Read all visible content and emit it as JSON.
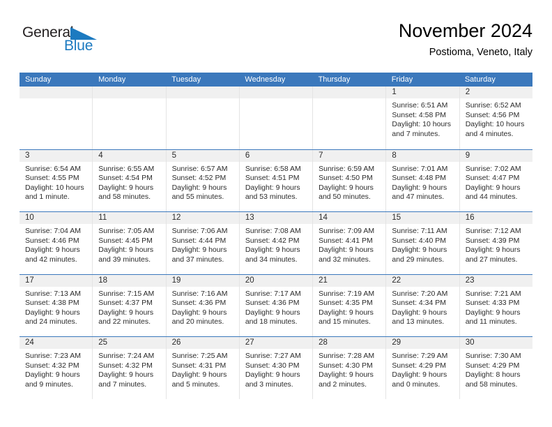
{
  "brand": {
    "name_top": "General",
    "name_bottom": "Blue",
    "triangle_icon": "blue-triangle-icon",
    "accent_color": "#1c7ac0"
  },
  "header": {
    "title": "November 2024",
    "subtitle": "Postioma, Veneto, Italy"
  },
  "theme": {
    "header_bg": "#3b78bc",
    "date_strip_bg": "#f0f0f0",
    "cell_border": "#e4e4e4",
    "text": "#2b2b2b"
  },
  "weekdays": [
    "Sunday",
    "Monday",
    "Tuesday",
    "Wednesday",
    "Thursday",
    "Friday",
    "Saturday"
  ],
  "labels": {
    "sunrise": "Sunrise:",
    "sunset": "Sunset:",
    "daylight": "Daylight:"
  },
  "weeks": [
    [
      {
        "day": "",
        "empty": true
      },
      {
        "day": "",
        "empty": true
      },
      {
        "day": "",
        "empty": true
      },
      {
        "day": "",
        "empty": true
      },
      {
        "day": "",
        "empty": true
      },
      {
        "day": "1",
        "sunrise": "Sunrise: 6:51 AM",
        "sunset": "Sunset: 4:58 PM",
        "daylight1": "Daylight: 10 hours",
        "daylight2": "and 7 minutes."
      },
      {
        "day": "2",
        "sunrise": "Sunrise: 6:52 AM",
        "sunset": "Sunset: 4:56 PM",
        "daylight1": "Daylight: 10 hours",
        "daylight2": "and 4 minutes."
      }
    ],
    [
      {
        "day": "3",
        "sunrise": "Sunrise: 6:54 AM",
        "sunset": "Sunset: 4:55 PM",
        "daylight1": "Daylight: 10 hours",
        "daylight2": "and 1 minute."
      },
      {
        "day": "4",
        "sunrise": "Sunrise: 6:55 AM",
        "sunset": "Sunset: 4:54 PM",
        "daylight1": "Daylight: 9 hours",
        "daylight2": "and 58 minutes."
      },
      {
        "day": "5",
        "sunrise": "Sunrise: 6:57 AM",
        "sunset": "Sunset: 4:52 PM",
        "daylight1": "Daylight: 9 hours",
        "daylight2": "and 55 minutes."
      },
      {
        "day": "6",
        "sunrise": "Sunrise: 6:58 AM",
        "sunset": "Sunset: 4:51 PM",
        "daylight1": "Daylight: 9 hours",
        "daylight2": "and 53 minutes."
      },
      {
        "day": "7",
        "sunrise": "Sunrise: 6:59 AM",
        "sunset": "Sunset: 4:50 PM",
        "daylight1": "Daylight: 9 hours",
        "daylight2": "and 50 minutes."
      },
      {
        "day": "8",
        "sunrise": "Sunrise: 7:01 AM",
        "sunset": "Sunset: 4:48 PM",
        "daylight1": "Daylight: 9 hours",
        "daylight2": "and 47 minutes."
      },
      {
        "day": "9",
        "sunrise": "Sunrise: 7:02 AM",
        "sunset": "Sunset: 4:47 PM",
        "daylight1": "Daylight: 9 hours",
        "daylight2": "and 44 minutes."
      }
    ],
    [
      {
        "day": "10",
        "sunrise": "Sunrise: 7:04 AM",
        "sunset": "Sunset: 4:46 PM",
        "daylight1": "Daylight: 9 hours",
        "daylight2": "and 42 minutes."
      },
      {
        "day": "11",
        "sunrise": "Sunrise: 7:05 AM",
        "sunset": "Sunset: 4:45 PM",
        "daylight1": "Daylight: 9 hours",
        "daylight2": "and 39 minutes."
      },
      {
        "day": "12",
        "sunrise": "Sunrise: 7:06 AM",
        "sunset": "Sunset: 4:44 PM",
        "daylight1": "Daylight: 9 hours",
        "daylight2": "and 37 minutes."
      },
      {
        "day": "13",
        "sunrise": "Sunrise: 7:08 AM",
        "sunset": "Sunset: 4:42 PM",
        "daylight1": "Daylight: 9 hours",
        "daylight2": "and 34 minutes."
      },
      {
        "day": "14",
        "sunrise": "Sunrise: 7:09 AM",
        "sunset": "Sunset: 4:41 PM",
        "daylight1": "Daylight: 9 hours",
        "daylight2": "and 32 minutes."
      },
      {
        "day": "15",
        "sunrise": "Sunrise: 7:11 AM",
        "sunset": "Sunset: 4:40 PM",
        "daylight1": "Daylight: 9 hours",
        "daylight2": "and 29 minutes."
      },
      {
        "day": "16",
        "sunrise": "Sunrise: 7:12 AM",
        "sunset": "Sunset: 4:39 PM",
        "daylight1": "Daylight: 9 hours",
        "daylight2": "and 27 minutes."
      }
    ],
    [
      {
        "day": "17",
        "sunrise": "Sunrise: 7:13 AM",
        "sunset": "Sunset: 4:38 PM",
        "daylight1": "Daylight: 9 hours",
        "daylight2": "and 24 minutes."
      },
      {
        "day": "18",
        "sunrise": "Sunrise: 7:15 AM",
        "sunset": "Sunset: 4:37 PM",
        "daylight1": "Daylight: 9 hours",
        "daylight2": "and 22 minutes."
      },
      {
        "day": "19",
        "sunrise": "Sunrise: 7:16 AM",
        "sunset": "Sunset: 4:36 PM",
        "daylight1": "Daylight: 9 hours",
        "daylight2": "and 20 minutes."
      },
      {
        "day": "20",
        "sunrise": "Sunrise: 7:17 AM",
        "sunset": "Sunset: 4:36 PM",
        "daylight1": "Daylight: 9 hours",
        "daylight2": "and 18 minutes."
      },
      {
        "day": "21",
        "sunrise": "Sunrise: 7:19 AM",
        "sunset": "Sunset: 4:35 PM",
        "daylight1": "Daylight: 9 hours",
        "daylight2": "and 15 minutes."
      },
      {
        "day": "22",
        "sunrise": "Sunrise: 7:20 AM",
        "sunset": "Sunset: 4:34 PM",
        "daylight1": "Daylight: 9 hours",
        "daylight2": "and 13 minutes."
      },
      {
        "day": "23",
        "sunrise": "Sunrise: 7:21 AM",
        "sunset": "Sunset: 4:33 PM",
        "daylight1": "Daylight: 9 hours",
        "daylight2": "and 11 minutes."
      }
    ],
    [
      {
        "day": "24",
        "sunrise": "Sunrise: 7:23 AM",
        "sunset": "Sunset: 4:32 PM",
        "daylight1": "Daylight: 9 hours",
        "daylight2": "and 9 minutes."
      },
      {
        "day": "25",
        "sunrise": "Sunrise: 7:24 AM",
        "sunset": "Sunset: 4:32 PM",
        "daylight1": "Daylight: 9 hours",
        "daylight2": "and 7 minutes."
      },
      {
        "day": "26",
        "sunrise": "Sunrise: 7:25 AM",
        "sunset": "Sunset: 4:31 PM",
        "daylight1": "Daylight: 9 hours",
        "daylight2": "and 5 minutes."
      },
      {
        "day": "27",
        "sunrise": "Sunrise: 7:27 AM",
        "sunset": "Sunset: 4:30 PM",
        "daylight1": "Daylight: 9 hours",
        "daylight2": "and 3 minutes."
      },
      {
        "day": "28",
        "sunrise": "Sunrise: 7:28 AM",
        "sunset": "Sunset: 4:30 PM",
        "daylight1": "Daylight: 9 hours",
        "daylight2": "and 2 minutes."
      },
      {
        "day": "29",
        "sunrise": "Sunrise: 7:29 AM",
        "sunset": "Sunset: 4:29 PM",
        "daylight1": "Daylight: 9 hours",
        "daylight2": "and 0 minutes."
      },
      {
        "day": "30",
        "sunrise": "Sunrise: 7:30 AM",
        "sunset": "Sunset: 4:29 PM",
        "daylight1": "Daylight: 8 hours",
        "daylight2": "and 58 minutes."
      }
    ]
  ]
}
